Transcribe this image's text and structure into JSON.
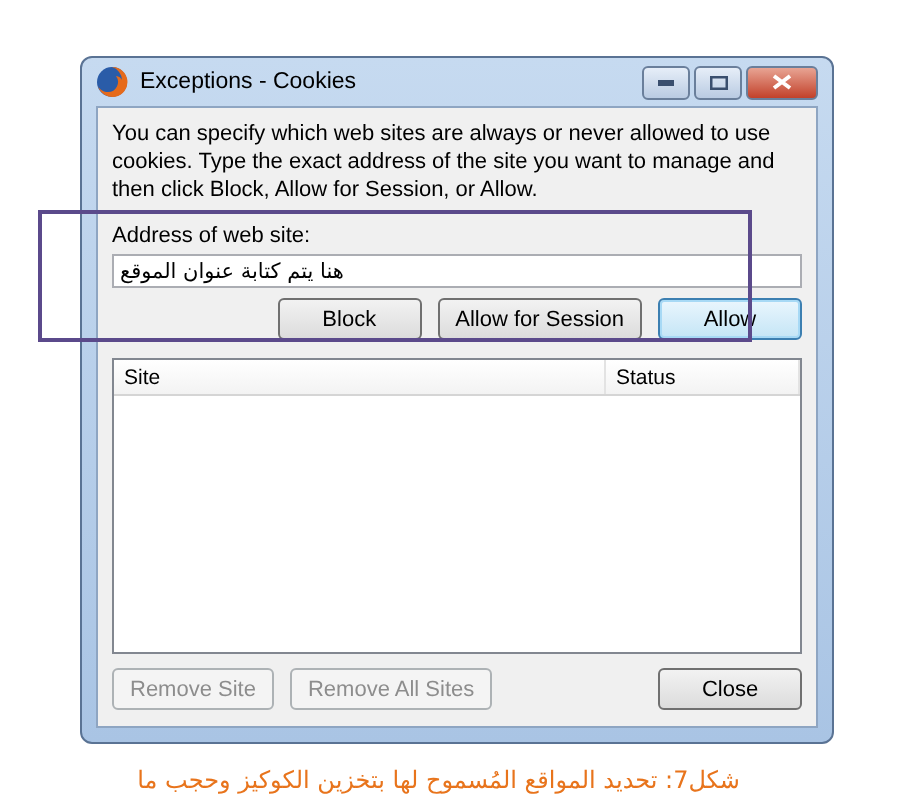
{
  "window": {
    "title": "Exceptions - Cookies"
  },
  "description": "You can specify which web sites are always or never allowed to use cookies. Type the exact address of the site you want to manage and then click Block, Allow for Session, or Allow.",
  "address": {
    "label": "Address of web site:",
    "value": "هنا يتم كتابة عنوان الموقع"
  },
  "action_buttons": [
    {
      "label": "Block",
      "default": false,
      "disabled": false
    },
    {
      "label": "Allow for Session",
      "default": false,
      "disabled": false
    },
    {
      "label": "Allow",
      "default": true,
      "disabled": false
    }
  ],
  "table": {
    "columns": [
      "Site",
      "Status"
    ]
  },
  "bottom_buttons": [
    {
      "label": "Remove Site",
      "default": false,
      "disabled": true
    },
    {
      "label": "Remove All Sites",
      "default": false,
      "disabled": true
    },
    {
      "label": "Close",
      "default": false,
      "disabled": false
    }
  ],
  "caption": "شكل7: تحديد المواقع المُسموح لها بتخزين الكوكيز وحجب ما"
}
